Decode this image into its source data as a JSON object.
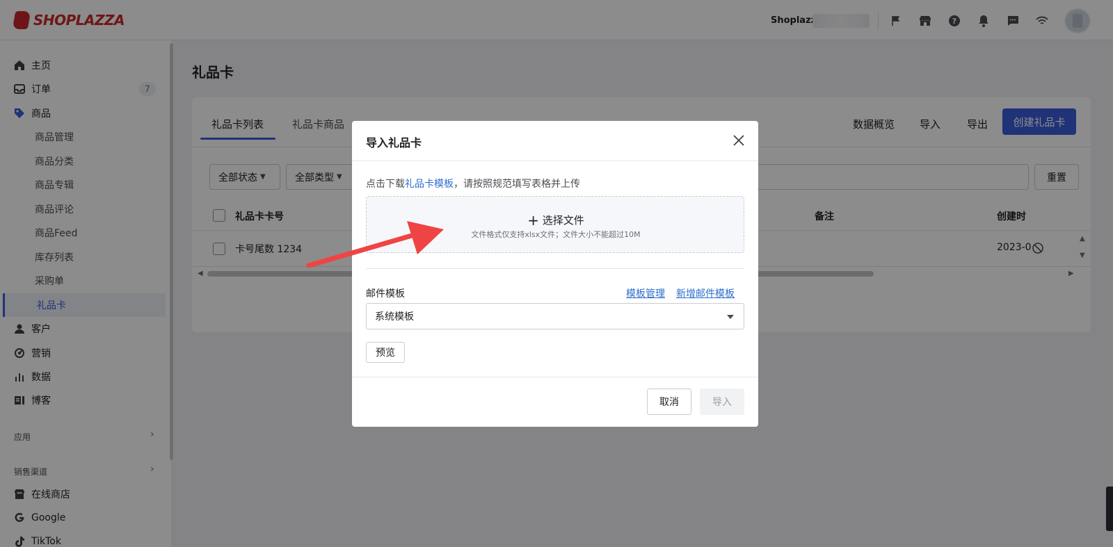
{
  "topbar": {
    "logo_text": "SHOPLAZZA",
    "store_name": "Shoplazza",
    "icons": [
      "flag-icon",
      "store-icon",
      "help-icon",
      "bell-icon",
      "chat-icon",
      "wifi-icon"
    ]
  },
  "sidebar": {
    "items": [
      {
        "label": "主页",
        "icon": "home-icon"
      },
      {
        "label": "订单",
        "icon": "inbox-icon",
        "badge": "7"
      },
      {
        "label": "商品",
        "icon": "tag-icon"
      }
    ],
    "sub_items": [
      "商品管理",
      "商品分类",
      "商品专辑",
      "商品评论",
      "商品Feed",
      "库存列表",
      "采购单",
      "礼品卡"
    ],
    "items_after": [
      {
        "label": "客户",
        "icon": "person-icon"
      },
      {
        "label": "营销",
        "icon": "marketing-icon"
      },
      {
        "label": "数据",
        "icon": "chart-icon"
      },
      {
        "label": "博客",
        "icon": "blog-icon"
      }
    ],
    "section_apps": "应用",
    "section_channels": "销售渠道",
    "channels": [
      {
        "label": "在线商店",
        "icon": "store-icon"
      },
      {
        "label": "Google",
        "icon": "google-icon"
      },
      {
        "label": "TikTok",
        "icon": "tiktok-icon"
      }
    ]
  },
  "main": {
    "page_title": "礼品卡",
    "tabs": [
      "礼品卡列表",
      "礼品卡商品"
    ],
    "actions": [
      "数据概览",
      "导入",
      "导出"
    ],
    "primary_action": "创建礼品卡",
    "filters": [
      "全部状态",
      "全部类型"
    ],
    "reset": "重置",
    "columns": {
      "card_no": "礼品卡卡号",
      "note": "备注",
      "created": "创建时"
    },
    "row": {
      "card_no": "卡号尾数 1234",
      "created": "2023-0"
    }
  },
  "modal": {
    "title": "导入礼品卡",
    "hint_prefix": "点击下载",
    "hint_link": "礼品卡模板",
    "hint_suffix": "，请按照规范填写表格并上传",
    "upload_label": "选择文件",
    "upload_note": "文件格式仅支持xlsx文件；文件大小不能超过10M",
    "email_template_label": "邮件模板",
    "manage_link": "模板管理",
    "new_link": "新增邮件模板",
    "selected_template": "系统模板",
    "preview": "预览",
    "cancel": "取消",
    "import": "导入"
  },
  "colors": {
    "brand": "#c8282a",
    "primary": "#3b5bdb",
    "link": "#2c6ecb",
    "annotation_arrow": "#ef4444"
  }
}
